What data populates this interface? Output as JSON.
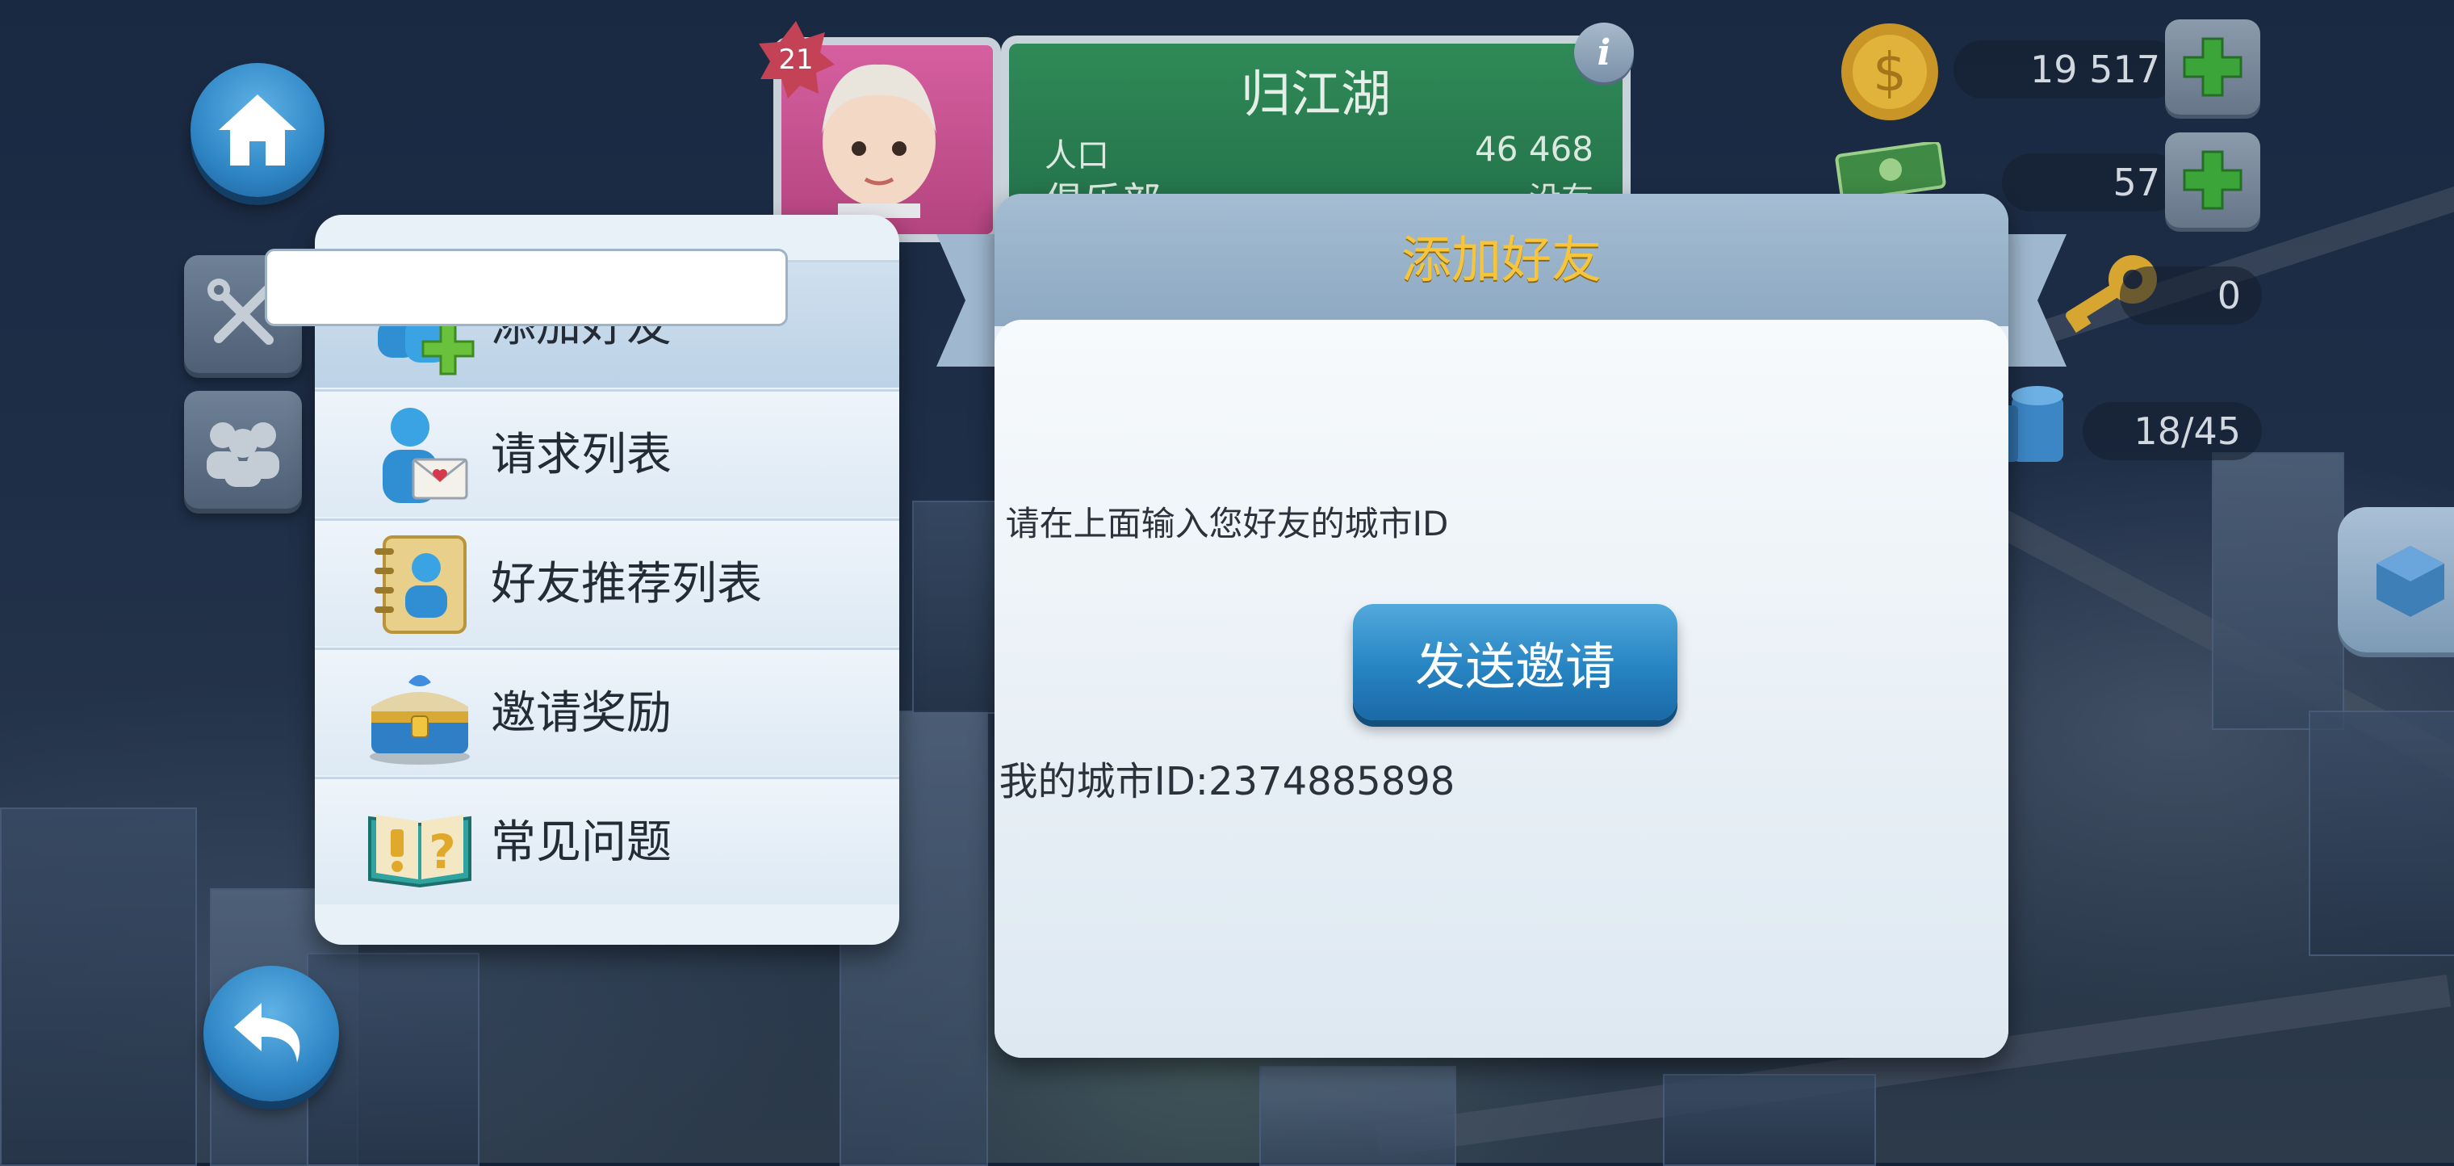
{
  "profile": {
    "level": "21",
    "city_name": "归江湖",
    "population_label": "人口",
    "population_value": "46 468",
    "club_label": "俱乐部",
    "club_value": "没有"
  },
  "currencies": {
    "simoleons": "19 517",
    "simcash": "57",
    "keys": "0",
    "storage": "18/45"
  },
  "menu": {
    "items": [
      {
        "label": "添加好友",
        "icon": "add-friend-icon",
        "active": true
      },
      {
        "label": "请求列表",
        "icon": "request-list-icon"
      },
      {
        "label": "好友推荐列表",
        "icon": "friend-recommend-icon"
      },
      {
        "label": "邀请奖励",
        "icon": "invite-reward-chest-icon"
      },
      {
        "label": "常见问题",
        "icon": "faq-book-icon"
      }
    ]
  },
  "dialog": {
    "title": "添加好友",
    "input_value": "",
    "hint": "请在上面输入您好友的城市ID",
    "send_button": "发送邀请",
    "my_city_id": "我的城市ID:2374885898"
  },
  "colors": {
    "title_gold": "#f7c53b",
    "button_blue": "#2784c2",
    "panel_bg": "#e9f1f8",
    "menu_active": "#c3d7ea"
  }
}
